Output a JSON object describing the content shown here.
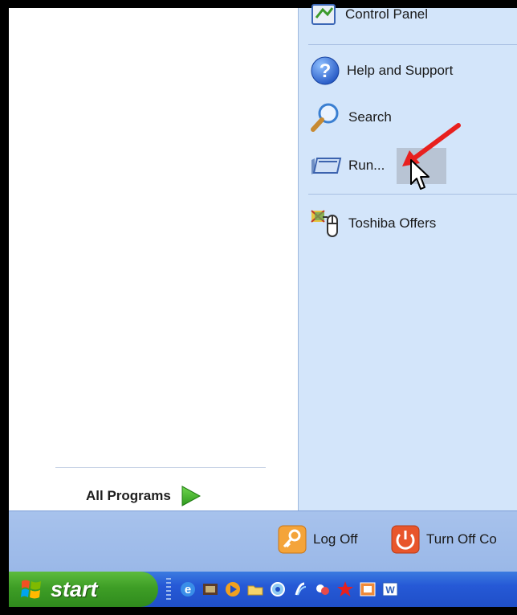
{
  "left_pane": {
    "all_programs_label": "All Programs"
  },
  "right_pane": {
    "items": [
      {
        "label": "Control Panel",
        "icon": "control-panel-icon"
      },
      {
        "label": "Help and Support",
        "icon": "help-icon"
      },
      {
        "label": "Search",
        "icon": "search-icon"
      },
      {
        "label": "Run...",
        "icon": "run-icon"
      },
      {
        "label": "Toshiba Offers",
        "icon": "toshiba-offers-icon"
      }
    ]
  },
  "bottom_bar": {
    "log_off_label": "Log Off",
    "turn_off_label": "Turn Off Co"
  },
  "taskbar": {
    "start_label": "start",
    "quick_launch_icons": [
      "internet-explorer-icon",
      "media-icon",
      "media-player-icon",
      "folder-icon",
      "search-quick-icon",
      "app-icon",
      "messenger-icon",
      "star-app-icon",
      "presentation-icon",
      "word-icon"
    ]
  },
  "colors": {
    "menu_right": "#d3e5fa",
    "taskbar": "#245edb",
    "start": "#3e9e26",
    "annotation_arrow": "#e8201e"
  }
}
